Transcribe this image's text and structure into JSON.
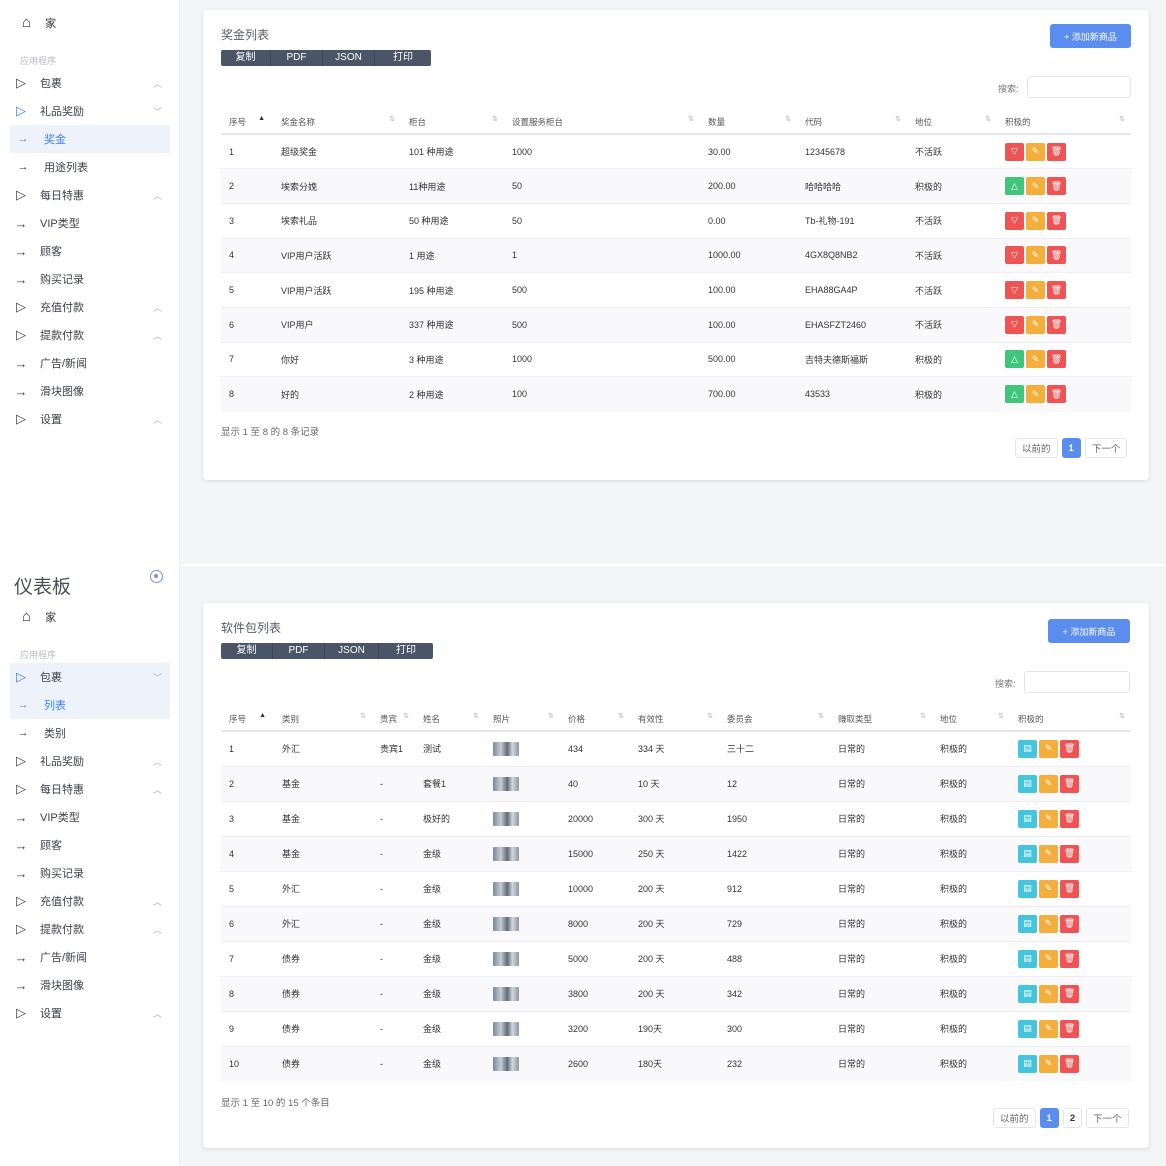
{
  "panel1": {
    "home": "家",
    "section": "应用程序",
    "menu": [
      {
        "icon": "triangle-right-icon",
        "label": "包裹",
        "chev": "^",
        "type": "main"
      },
      {
        "icon": "triangle-right-icon",
        "label": "礼品奖励",
        "chev": "v",
        "type": "main-open"
      },
      {
        "icon": "arrow-right-icon",
        "label": "奖金",
        "chev": "",
        "type": "sub-active"
      },
      {
        "icon": "arrow-right-icon",
        "label": "用途列表",
        "chev": "",
        "type": "sub"
      },
      {
        "icon": "triangle-right-icon",
        "label": "每日特惠",
        "chev": "^",
        "type": "main"
      },
      {
        "icon": "arrow-right-icon",
        "label": "VIP类型",
        "chev": "",
        "type": "main"
      },
      {
        "icon": "arrow-right-icon",
        "label": "顾客",
        "chev": "",
        "type": "main"
      },
      {
        "icon": "arrow-right-icon",
        "label": "购买记录",
        "chev": "",
        "type": "main"
      },
      {
        "icon": "triangle-right-icon",
        "label": "充值付款",
        "chev": "^",
        "type": "main"
      },
      {
        "icon": "triangle-right-icon",
        "label": "提款付款",
        "chev": "^",
        "type": "main"
      },
      {
        "icon": "arrow-right-icon",
        "label": "广告/新闻",
        "chev": "",
        "type": "main"
      },
      {
        "icon": "arrow-right-icon",
        "label": "滑块图像",
        "chev": "",
        "type": "main"
      },
      {
        "icon": "triangle-right-icon",
        "label": "设置",
        "chev": "^",
        "type": "main"
      }
    ],
    "card": {
      "title": "奖金列表",
      "export": [
        "复制",
        "PDF",
        "JSON",
        "打印"
      ],
      "add_button": "+ 添加新商品",
      "search_label": "搜索:",
      "search_placeholder": "",
      "headers": [
        "序号",
        "奖金名称",
        "柜台",
        "设置服务柜台",
        "数量",
        "代码",
        "地位",
        "积极的"
      ],
      "rows": [
        {
          "no": "1",
          "name": "超级奖金",
          "counter": "101 种用途",
          "service": "1000",
          "qty": "30.00",
          "code": "12345678",
          "status": "不活跃",
          "active": false
        },
        {
          "no": "2",
          "name": "埃索分娩",
          "counter": "11种用途",
          "service": "50",
          "qty": "200.00",
          "code": "哈哈哈哈",
          "status": "积极的",
          "active": true
        },
        {
          "no": "3",
          "name": "埃索礼品",
          "counter": "50 种用途",
          "service": "50",
          "qty": "0.00",
          "code": "Tb-礼物-191",
          "status": "不活跃",
          "active": false
        },
        {
          "no": "4",
          "name": "VIP用户活跃",
          "counter": "1 用途",
          "service": "1",
          "qty": "1000.00",
          "code": "4GX8Q8NB2",
          "status": "不活跃",
          "active": false
        },
        {
          "no": "5",
          "name": "VIP用户活跃",
          "counter": "195 种用途",
          "service": "500",
          "qty": "100.00",
          "code": "EHA88GA4P",
          "status": "不活跃",
          "active": false
        },
        {
          "no": "6",
          "name": "VIP用户",
          "counter": "337 种用途",
          "service": "500",
          "qty": "100.00",
          "code": "EHASFZT2460",
          "status": "不活跃",
          "active": false
        },
        {
          "no": "7",
          "name": "你好",
          "counter": "3 种用途",
          "service": "1000",
          "qty": "500.00",
          "code": "吉特夫德斯福斯",
          "status": "积极的",
          "active": true
        },
        {
          "no": "8",
          "name": "好的",
          "counter": "2 种用途",
          "service": "100",
          "qty": "700.00",
          "code": "43533",
          "status": "积极的",
          "active": true
        }
      ],
      "info": "显示 1 至 8 的 8 条记录",
      "pager": {
        "prev": "以前的",
        "pages": [
          "1"
        ],
        "next": "下一个"
      }
    }
  },
  "panel2": {
    "dashboard_title": "仪表板",
    "home": "家",
    "section": "应用程序",
    "menu": [
      {
        "icon": "triangle-right-icon",
        "label": "包裹",
        "chev": "v",
        "type": "main-open-active"
      },
      {
        "icon": "arrow-right-icon",
        "label": "列表",
        "chev": "",
        "type": "sub-active"
      },
      {
        "icon": "arrow-right-icon",
        "label": "类别",
        "chev": "",
        "type": "sub"
      },
      {
        "icon": "triangle-right-icon",
        "label": "礼品奖励",
        "chev": "^",
        "type": "main"
      },
      {
        "icon": "triangle-right-icon",
        "label": "每日特惠",
        "chev": "^",
        "type": "main"
      },
      {
        "icon": "arrow-right-icon",
        "label": "VIP类型",
        "chev": "",
        "type": "main"
      },
      {
        "icon": "arrow-right-icon",
        "label": "顾客",
        "chev": "",
        "type": "main"
      },
      {
        "icon": "arrow-right-icon",
        "label": "购买记录",
        "chev": "",
        "type": "main"
      },
      {
        "icon": "triangle-right-icon",
        "label": "充值付款",
        "chev": "^",
        "type": "main"
      },
      {
        "icon": "triangle-right-icon",
        "label": "提款付款",
        "chev": "^",
        "type": "main"
      },
      {
        "icon": "arrow-right-icon",
        "label": "广告/新闻",
        "chev": "",
        "type": "main"
      },
      {
        "icon": "arrow-right-icon",
        "label": "滑块图像",
        "chev": "",
        "type": "main"
      },
      {
        "icon": "triangle-right-icon",
        "label": "设置",
        "chev": "^",
        "type": "main"
      }
    ],
    "card": {
      "title": "软件包列表",
      "export": [
        "复制",
        "PDF",
        "JSON",
        "打印"
      ],
      "add_button": "+ 添加新商品",
      "search_label": "搜索:",
      "search_placeholder": "",
      "headers": [
        "序号",
        "类别",
        "贵宾",
        "姓名",
        "照片",
        "价格",
        "有效性",
        "委员会",
        "赚取类型",
        "地位",
        "积极的"
      ],
      "rows": [
        {
          "no": "1",
          "cat": "外汇",
          "vip": "贵宾1",
          "name": "测试",
          "price": "434",
          "valid": "334 天",
          "commission": "三十二",
          "earn": "日常的",
          "status": "积极的"
        },
        {
          "no": "2",
          "cat": "基金",
          "vip": "-",
          "name": "套餐1",
          "price": "40",
          "valid": "10 天",
          "commission": "12",
          "earn": "日常的",
          "status": "积极的"
        },
        {
          "no": "3",
          "cat": "基金",
          "vip": "-",
          "name": "极好的",
          "price": "20000",
          "valid": "300 天",
          "commission": "1950",
          "earn": "日常的",
          "status": "积极的"
        },
        {
          "no": "4",
          "cat": "基金",
          "vip": "-",
          "name": "金级",
          "price": "15000",
          "valid": "250 天",
          "commission": "1422",
          "earn": "日常的",
          "status": "积极的"
        },
        {
          "no": "5",
          "cat": "外汇",
          "vip": "-",
          "name": "金级",
          "price": "10000",
          "valid": "200 天",
          "commission": "912",
          "earn": "日常的",
          "status": "积极的"
        },
        {
          "no": "6",
          "cat": "外汇",
          "vip": "-",
          "name": "金级",
          "price": "8000",
          "valid": "200 天",
          "commission": "729",
          "earn": "日常的",
          "status": "积极的"
        },
        {
          "no": "7",
          "cat": "债券",
          "vip": "-",
          "name": "金级",
          "price": "5000",
          "valid": "200 天",
          "commission": "488",
          "earn": "日常的",
          "status": "积极的"
        },
        {
          "no": "8",
          "cat": "债券",
          "vip": "-",
          "name": "金级",
          "price": "3800",
          "valid": "200 天",
          "commission": "342",
          "earn": "日常的",
          "status": "积极的"
        },
        {
          "no": "9",
          "cat": "债券",
          "vip": "-",
          "name": "金级",
          "price": "3200",
          "valid": "190天",
          "commission": "300",
          "earn": "日常的",
          "status": "积极的"
        },
        {
          "no": "10",
          "cat": "债券",
          "vip": "-",
          "name": "金级",
          "price": "2600",
          "valid": "180天",
          "commission": "232",
          "earn": "日常的",
          "status": "积极的"
        }
      ],
      "info": "显示 1 至 10 的 15 个条目",
      "pager": {
        "prev": "以前的",
        "pages": [
          "1",
          "2"
        ],
        "next": "下一个"
      }
    }
  },
  "colors": {
    "primary": "#5b8def",
    "danger": "#ef5354",
    "success": "#40c57a",
    "warning": "#f4ae3c",
    "info": "#45c4dd",
    "export_bg": "#4b5568"
  }
}
